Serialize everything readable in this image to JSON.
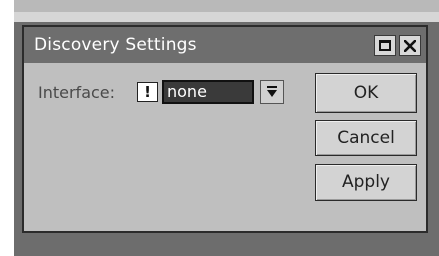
{
  "window": {
    "title": "Discovery Settings"
  },
  "form": {
    "interface_label": "Interface:",
    "interface_value": "none"
  },
  "buttons": {
    "ok": "OK",
    "cancel": "Cancel",
    "apply": "Apply"
  },
  "icons": {
    "warning": "exclamation-icon",
    "dropdown": "dropdown-arrow-icon",
    "maximize": "maximize-icon",
    "close": "close-icon"
  }
}
